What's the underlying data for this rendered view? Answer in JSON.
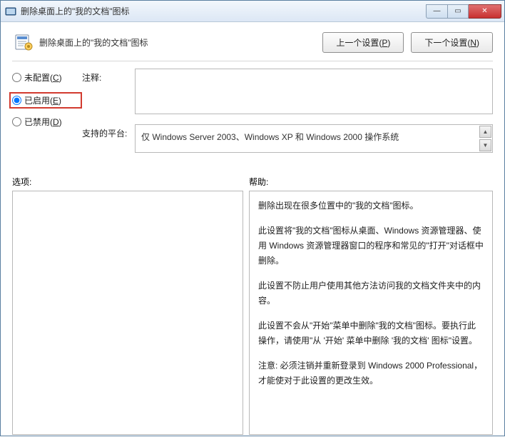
{
  "window": {
    "title": "删除桌面上的\"我的文档\"图标"
  },
  "header": {
    "title": "删除桌面上的\"我的文档\"图标",
    "prev_button": "上一个设置(",
    "prev_accel": "P",
    "prev_button_tail": ")",
    "next_button": "下一个设置(",
    "next_accel": "N",
    "next_button_tail": ")"
  },
  "radios": {
    "not_configured": "未配置(",
    "not_configured_accel": "C",
    "not_configured_tail": ")",
    "enabled": "已启用(",
    "enabled_accel": "E",
    "enabled_tail": ")",
    "disabled": "已禁用(",
    "disabled_accel": "D",
    "disabled_tail": ")",
    "selected": "enabled"
  },
  "fields": {
    "comment_label": "注释:",
    "comment_value": "",
    "platform_label": "支持的平台:",
    "platform_value": "仅 Windows Server 2003、Windows XP 和 Windows 2000 操作系统"
  },
  "sections": {
    "options_label": "选项:",
    "help_label": "帮助:"
  },
  "help": {
    "p1": "删除出现在很多位置中的\"我的文档\"图标。",
    "p2": "此设置将\"我的文档\"图标从桌面、Windows 资源管理器、使用 Windows 资源管理器窗口的程序和常见的\"打开\"对话框中删除。",
    "p3": "此设置不防止用户使用其他方法访问我的文档文件夹中的内容。",
    "p4": "此设置不会从\"开始\"菜单中删除\"我的文档\"图标。要执行此操作，请使用\"从 '开始' 菜单中删除 '我的文档' 图标\"设置。",
    "p5": "注意: 必须注销并重新登录到 Windows 2000 Professional，才能使对于此设置的更改生效。"
  },
  "win_controls": {
    "min": "—",
    "max": "▭",
    "close": "✕"
  }
}
